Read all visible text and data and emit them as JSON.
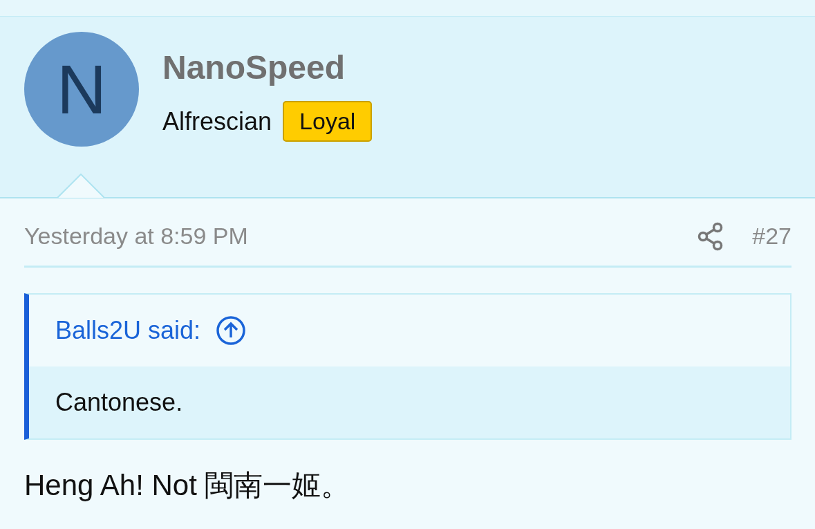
{
  "post": {
    "avatar_letter": "N",
    "username": "NanoSpeed",
    "user_title": "Alfrescian",
    "badge": "Loyal",
    "date": "Yesterday at 8:59 PM",
    "number": "#27",
    "quote": {
      "author": "Balls2U said:",
      "text": "Cantonese."
    },
    "message": "Heng Ah! Not 閩南一姬。"
  }
}
